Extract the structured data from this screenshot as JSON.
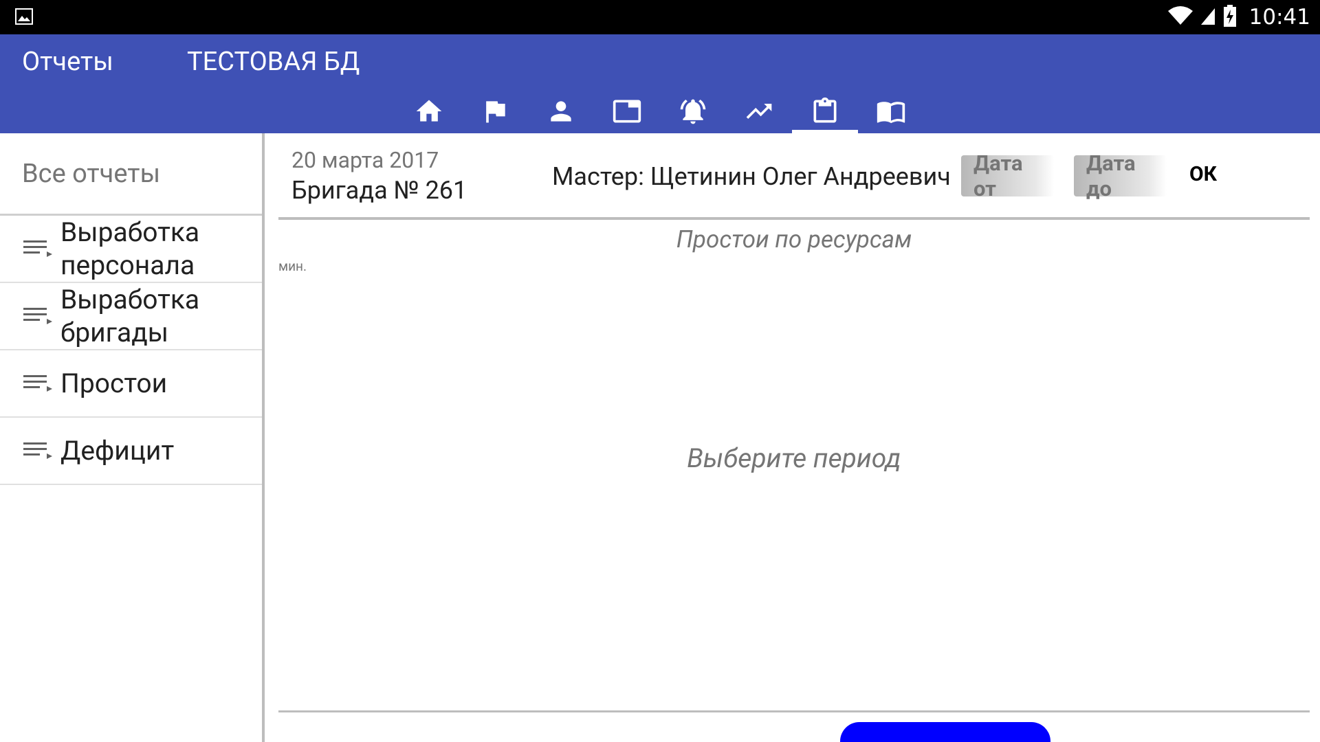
{
  "status_bar": {
    "left_icon": "image-icon",
    "right_icons": [
      "wifi-icon",
      "signal-icon",
      "battery-charging-icon"
    ],
    "time": "10:41"
  },
  "app_bar": {
    "title": "Отчеты",
    "database": "ТЕСТОВАЯ БД",
    "color": "#3f51b5",
    "tabs": [
      {
        "icon": "home-icon",
        "active": false
      },
      {
        "icon": "flag-icon",
        "active": false
      },
      {
        "icon": "person-icon",
        "active": false
      },
      {
        "icon": "tab-window-icon",
        "active": false
      },
      {
        "icon": "alarm-bell-icon",
        "active": false
      },
      {
        "icon": "trending-up-icon",
        "active": false
      },
      {
        "icon": "clipboard-icon",
        "active": true
      },
      {
        "icon": "book-icon",
        "active": false
      }
    ]
  },
  "sidebar": {
    "header": "Все отчеты",
    "items": [
      {
        "label_line1": "Выработка",
        "label_line2": "персонала",
        "icon": "list-play-icon"
      },
      {
        "label_line1": "Выработка",
        "label_line2": "бригады",
        "icon": "list-play-icon"
      },
      {
        "label_line1": "Простои",
        "label_line2": "",
        "icon": "list-play-icon"
      },
      {
        "label_line1": "Дефицит",
        "label_line2": "",
        "icon": "list-play-icon"
      }
    ]
  },
  "report_header": {
    "date": "20 марта 2017",
    "brigade": "Бригада № 261",
    "master": "Мастер: Щетинин Олег Андреевич",
    "date_from_button": "Дата от",
    "date_to_button": "Дата до",
    "ok_button": "ОК"
  },
  "report": {
    "title": "Простои по ресурсам",
    "unit": "мин.",
    "empty_message": "Выберите период"
  },
  "bottom_button": {
    "color": "#0000ff"
  }
}
